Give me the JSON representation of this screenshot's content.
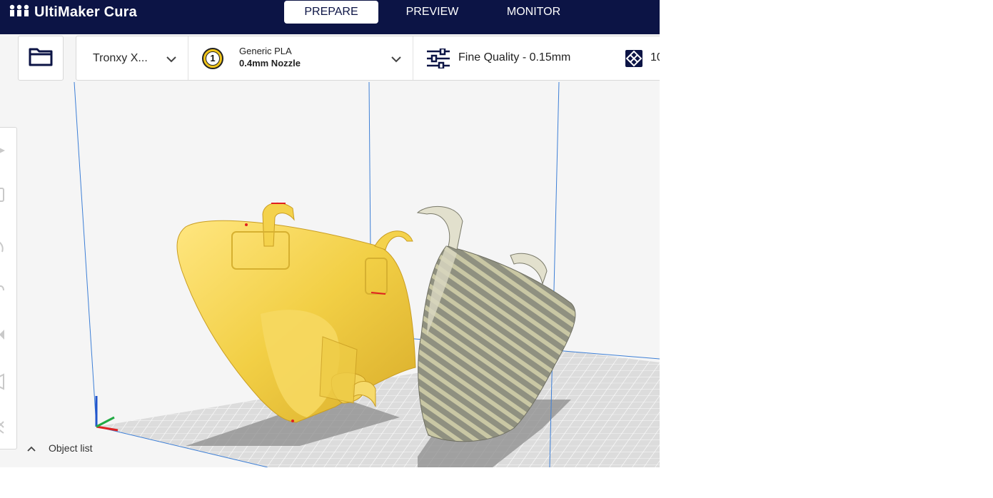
{
  "app": {
    "name": "UltiMaker Cura"
  },
  "stages": [
    {
      "label": "PREPARE",
      "active": true
    },
    {
      "label": "PREVIEW",
      "active": false
    },
    {
      "label": "MONITOR",
      "active": false
    }
  ],
  "toolbar_top": {
    "open_icon": "folder-icon",
    "printer": {
      "name": "Tronxy X..."
    },
    "material": {
      "extruder_number": "1",
      "type": "Generic PLA",
      "nozzle": "0.4mm Nozzle",
      "color": "#f0c419"
    },
    "quality": {
      "label": "Fine Quality - 0.15mm",
      "icon": "sliders-icon"
    },
    "infill": {
      "label": "10",
      "icon": "infill-icon"
    }
  },
  "left_tools": [
    {
      "name": "move-tool-icon"
    },
    {
      "name": "scale-tool-icon"
    },
    {
      "name": "rotate-tool-icon"
    },
    {
      "name": "mirror-tool-icon"
    },
    {
      "name": "per-model-settings-icon"
    },
    {
      "name": "support-blocker-icon"
    },
    {
      "name": "paint-tool-icon"
    }
  ],
  "object_list": {
    "label": "Object list"
  },
  "colors": {
    "header_bg": "#0c1445",
    "model_selected": "#f0c419",
    "model_other": "#9a9a86",
    "build_plate": "#d9d9d9"
  }
}
